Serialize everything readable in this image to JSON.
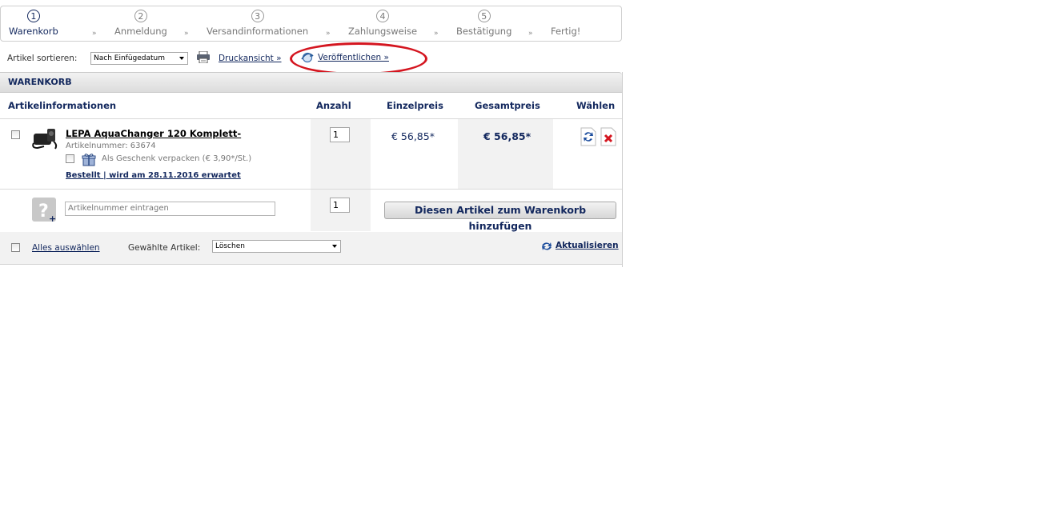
{
  "steps": [
    {
      "num": "1",
      "label": "Warenkorb"
    },
    {
      "num": "2",
      "label": "Anmeldung"
    },
    {
      "num": "3",
      "label": "Versandinformationen"
    },
    {
      "num": "4",
      "label": "Zahlungsweise"
    },
    {
      "num": "5",
      "label": "Bestätigung"
    },
    {
      "num": "",
      "label": "Fertig!"
    }
  ],
  "step_separator": "»",
  "toolbar": {
    "sort_label": "Artikel sortieren:",
    "sort_value": "Nach Einfügedatum",
    "print_label": "Druckansicht »",
    "publish_label": "Veröffentlichen »"
  },
  "cart": {
    "title": "WARENKORB",
    "columns": {
      "info": "Artikelinformationen",
      "qty": "Anzahl",
      "unit": "Einzelpreis",
      "total": "Gesamtpreis",
      "select": "Wählen"
    },
    "item": {
      "title": "LEPA AquaChanger 120 Komplett-",
      "article_number": "Artikelnummer: 63674",
      "gift_wrap": "Als Geschenk verpacken (€ 3,90*/St.)",
      "status": "Bestellt | wird am 28.11.2016 erwartet",
      "quantity": "1",
      "unit_price": "€ 56,85*",
      "total_price": "€ 56,85*"
    },
    "add_row": {
      "placeholder": "Artikelnummer eintragen",
      "quantity": "1",
      "button": "Diesen Artikel zum Warenkorb hinzufügen"
    },
    "footer": {
      "select_all": "Alles auswählen",
      "selected_label": "Gewählte Artikel:",
      "action_value": "Löschen",
      "refresh": "Aktualisieren"
    }
  },
  "icons": [
    "printer-icon",
    "publish-icon",
    "product-image",
    "gift-icon",
    "refresh-icon",
    "delete-icon",
    "unknown-article-icon"
  ],
  "colors": {
    "navy": "#13285e",
    "highlight_red": "#d4151f",
    "header_grey": "#dcdcdc"
  }
}
